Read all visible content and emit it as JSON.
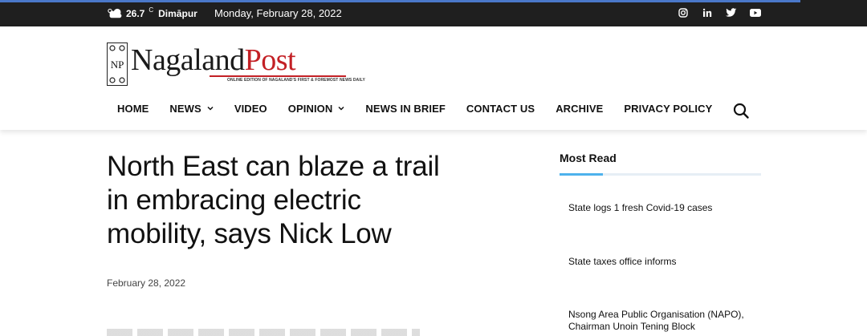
{
  "topbar": {
    "temperature": "26.7",
    "temp_unit": "C",
    "city": "Dimāpur",
    "date": "Monday, February 28, 2022",
    "socials": [
      "instagram-icon",
      "linkedin-icon",
      "twitter-icon",
      "youtube-icon"
    ]
  },
  "logo": {
    "np": "NP",
    "name_part1": "Nagaland",
    "name_part2": "Post",
    "tagline": "ONLINE EDITION OF NAGALAND'S FIRST & FOREMOST NEWS DAILY"
  },
  "nav": {
    "items": [
      {
        "label": "HOME"
      },
      {
        "label": "NEWS"
      },
      {
        "label": "VIDEO"
      },
      {
        "label": "OPINION"
      },
      {
        "label": "NEWS IN BRIEF"
      },
      {
        "label": "CONTACT US"
      },
      {
        "label": "ARCHIVE"
      },
      {
        "label": "PRIVACY POLICY"
      }
    ]
  },
  "article": {
    "title": "North East can blaze a trail in embracing electric mobility, says Nick Low",
    "date": "February 28, 2022"
  },
  "sidebar": {
    "heading": "Most Read",
    "items": [
      {
        "title": "State logs 1 fresh Covid-19 cases"
      },
      {
        "title": "State taxes office informs"
      },
      {
        "title": "Nsong Area Public Organisation (NAPO), Chairman Unoin Tening Block"
      }
    ]
  },
  "colors": {
    "topbar": "#1f1f1f",
    "accent_blue": "#4a78c9",
    "logo_red": "#c32025",
    "sidebar_accent": "#4db2ec"
  }
}
